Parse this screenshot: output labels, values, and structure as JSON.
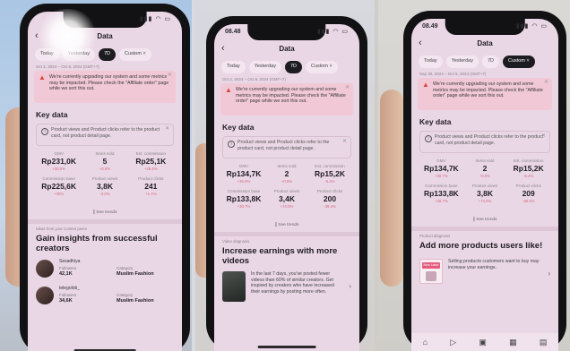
{
  "screens": [
    {
      "time": "",
      "title": "Data",
      "tabs": [
        "Today",
        "Yesterday",
        "7D",
        "Custom ˅"
      ],
      "active_tab": 2,
      "date_range": "Oct 2, 2024 – Oct 8, 2024 (GMT+7)",
      "notice": "We're currently upgrading our system and some metrics may be impacted. Please check the \"Affiliate order\" page while we sort this out.",
      "key_data": "Key data",
      "info": "Product views and Product clicks refer to the product card, not product detail page.",
      "metrics": [
        {
          "label": "GMV",
          "value": "Rp231,0K",
          "change": "+30.0%"
        },
        {
          "label": "Items sold",
          "value": "5",
          "change": "+0.0%"
        },
        {
          "label": "Est. commission",
          "value": "Rp25,1K",
          "change": "+28.6%"
        },
        {
          "label": "Commission base",
          "value": "Rp225,6K",
          "change": "+30%"
        },
        {
          "label": "Product views",
          "value": "3,8K",
          "change": "-3.0%"
        },
        {
          "label": "Product clicks",
          "value": "241",
          "change": "+1.1%"
        }
      ],
      "see_trends": "∥ See trends",
      "section_label": "Ideas from your content peers",
      "headline": "Gain insights from successful creators",
      "creators": [
        {
          "name": "Sesadhiya",
          "followers_label": "Followers",
          "followers": "42,1K",
          "category_label": "Category",
          "category": "Muslim Fashion"
        },
        {
          "name": "telegolob_",
          "followers_label": "Followers",
          "followers": "34,6K",
          "category_label": "Category",
          "category": "Muslim Fashion"
        }
      ]
    },
    {
      "time": "08.48",
      "title": "Data",
      "tabs": [
        "Today",
        "Yesterday",
        "7D",
        "Custom ˅"
      ],
      "active_tab": 2,
      "date_range": "Oct 2, 2024 – Oct 8, 2024 (GMT+7)",
      "notice": "We're currently upgrading our system and some metrics may be impacted. Please check the \"Affiliate order\" page while we sort this out.",
      "key_data": "Key data",
      "info": "Product views and Product clicks refer to the product card, not product detail page.",
      "metrics": [
        {
          "label": "GMV",
          "value": "Rp134,7K",
          "change": "+30.0%"
        },
        {
          "label": "Items sold",
          "value": "2",
          "change": "+0.0%"
        },
        {
          "label": "Est. commission",
          "value": "Rp15,2K",
          "change": "-5.4%"
        },
        {
          "label": "Commission base",
          "value": "Rp133,8K",
          "change": "+30.7%"
        },
        {
          "label": "Product views",
          "value": "3,4K",
          "change": "+74.0%"
        },
        {
          "label": "Product clicks",
          "value": "200",
          "change": "-39.4%"
        }
      ],
      "see_trends": "∥ See trends",
      "section_label": "Video diagnosis",
      "headline": "Increase earnings with more videos",
      "article": "In the last 7 days, you've posted fewer videos than 60% of similar creators. Get inspired by creators who have increased their earnings by posting more often."
    },
    {
      "time": "08.49",
      "title": "Data",
      "tabs": [
        "Today",
        "Yesterday",
        "7D",
        "Custom ˅"
      ],
      "active_tab": 3,
      "date_range": "Sep 30, 2024 – Oct 6, 2024 (GMT+7)",
      "notice": "We're currently upgrading our system and some metrics may be impacted. Please check the \"Affiliate order\" page while we sort this out.",
      "key_data": "Key data",
      "info": "Product views and Product clicks refer to the product card, not product detail page.",
      "metrics": [
        {
          "label": "GMV",
          "value": "Rp134,7K",
          "change": "+30.7%"
        },
        {
          "label": "Items sold",
          "value": "2",
          "change": "+0.0%"
        },
        {
          "label": "Est. commission",
          "value": "Rp15,2K",
          "change": "-5.4%"
        },
        {
          "label": "Commission base",
          "value": "Rp133,8K",
          "change": "+30.7%"
        },
        {
          "label": "Product views",
          "value": "3,8K",
          "change": "+74.0%"
        },
        {
          "label": "Product clicks",
          "value": "209",
          "change": "-39.4%"
        }
      ],
      "see_trends": "∥ See trends",
      "section_label": "Product diagnosis",
      "headline": "Add more products users like!",
      "article": "Selling products customers want to buy may increase your earnings.",
      "thumb_label": "New Label"
    }
  ]
}
